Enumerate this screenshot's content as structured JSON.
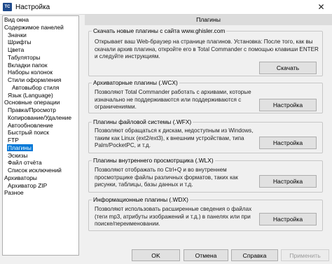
{
  "window": {
    "title": "Настройка",
    "icon": "TC",
    "close_glyph": "✕"
  },
  "tree": [
    {
      "label": "Вид окна",
      "indent": 0
    },
    {
      "label": "Содержимое панелей",
      "indent": 0
    },
    {
      "label": "Значки",
      "indent": 1
    },
    {
      "label": "Шрифты",
      "indent": 1
    },
    {
      "label": "Цвета",
      "indent": 1
    },
    {
      "label": "Табуляторы",
      "indent": 1
    },
    {
      "label": "Вкладки папок",
      "indent": 1
    },
    {
      "label": "Наборы колонок",
      "indent": 1
    },
    {
      "label": "Стили оформления",
      "indent": 1
    },
    {
      "label": "Автовыбор стиля",
      "indent": 2
    },
    {
      "label": "Язык (Language)",
      "indent": 1
    },
    {
      "label": "Основные операции",
      "indent": 0
    },
    {
      "label": "Правка/Просмотр",
      "indent": 1
    },
    {
      "label": "Копирование/Удаление",
      "indent": 1
    },
    {
      "label": "Автообновление",
      "indent": 1
    },
    {
      "label": "Быстрый поиск",
      "indent": 1
    },
    {
      "label": "FTP",
      "indent": 1
    },
    {
      "label": "Плагины",
      "indent": 1,
      "selected": true
    },
    {
      "label": "Эскизы",
      "indent": 1
    },
    {
      "label": "Файл отчёта",
      "indent": 1
    },
    {
      "label": "Список исключений",
      "indent": 1
    },
    {
      "label": "Архиваторы",
      "indent": 0
    },
    {
      "label": "Архиватор ZIP",
      "indent": 1
    },
    {
      "label": "Разное",
      "indent": 0
    }
  ],
  "page": {
    "header": "Плагины",
    "download": {
      "title": "Скачать новые плагины с сайта www.ghisler.com",
      "desc": "Открывает ваш Web-браузер на странице плагинов. Установка: После того, как вы скачали архив плагина, откройте его в Total Commander с помощью клавиши ENTER и следуйте инструкциям.",
      "button": "Скачать"
    },
    "wcx": {
      "title": "Архиваторные плагины (.WCX)",
      "desc": "Позволяют Total Commander работать с архивами, которые изначально не поддерживаются или поддерживаются с ограничениями.",
      "button": "Настройка"
    },
    "wfx": {
      "title": "Плагины файловой системы (.WFX)",
      "desc": "Позволяют обращаться к дискам, недоступным из Windows, таким как Linux (ext2/ext3), к внешним устройствам, типа Palm/PocketPC, и т.д.",
      "button": "Настройка"
    },
    "wlx": {
      "title": "Плагины внутреннего просмотрщика (.WLX)",
      "desc": "Позволяют отображать по Ctrl+Q и во внутреннем просмотрщике файлы различных форматов, таких как рисунки, таблицы, базы данных и т.д.",
      "button": "Настройка"
    },
    "wdx": {
      "title": "Информационные плагины (.WDX)",
      "desc": "Позволяют использовать расширенные сведения о файлах (теги mp3, атрибуты изображений и т.д.) в панелях или при поиске/переименовании.",
      "button": "Настройка"
    }
  },
  "footer": {
    "ok": "OK",
    "cancel": "Отмена",
    "help": "Справка",
    "apply": "Применить"
  },
  "colors": {
    "selection": "#0078d7",
    "header_bg": "#dcdcdc",
    "dialog_bg": "#f0f0f0"
  }
}
